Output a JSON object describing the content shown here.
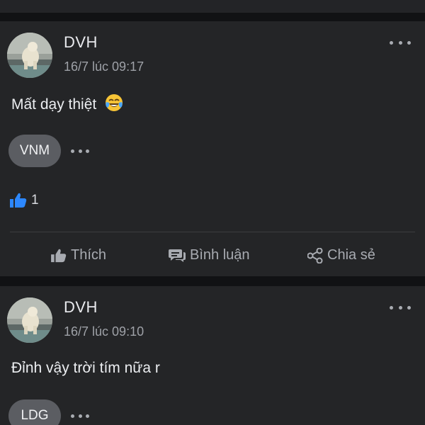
{
  "posts": [
    {
      "author": "DVH",
      "time": "16/7 lúc 09:17",
      "content": "Mất dạy thiệt",
      "emoji": "laughing-tears",
      "tag": "VNM",
      "like_count": "1",
      "actions": {
        "like": "Thích",
        "comment": "Bình luận",
        "share": "Chia sẻ"
      }
    },
    {
      "author": "DVH",
      "time": "16/7 lúc 09:10",
      "content": "Đỉnh vậy trời tím nữa r",
      "tag": "LDG"
    }
  ],
  "colors": {
    "background": "#111214",
    "card": "#242527",
    "accent_like": "#2d88ff",
    "muted_text": "#9ea1a7"
  }
}
